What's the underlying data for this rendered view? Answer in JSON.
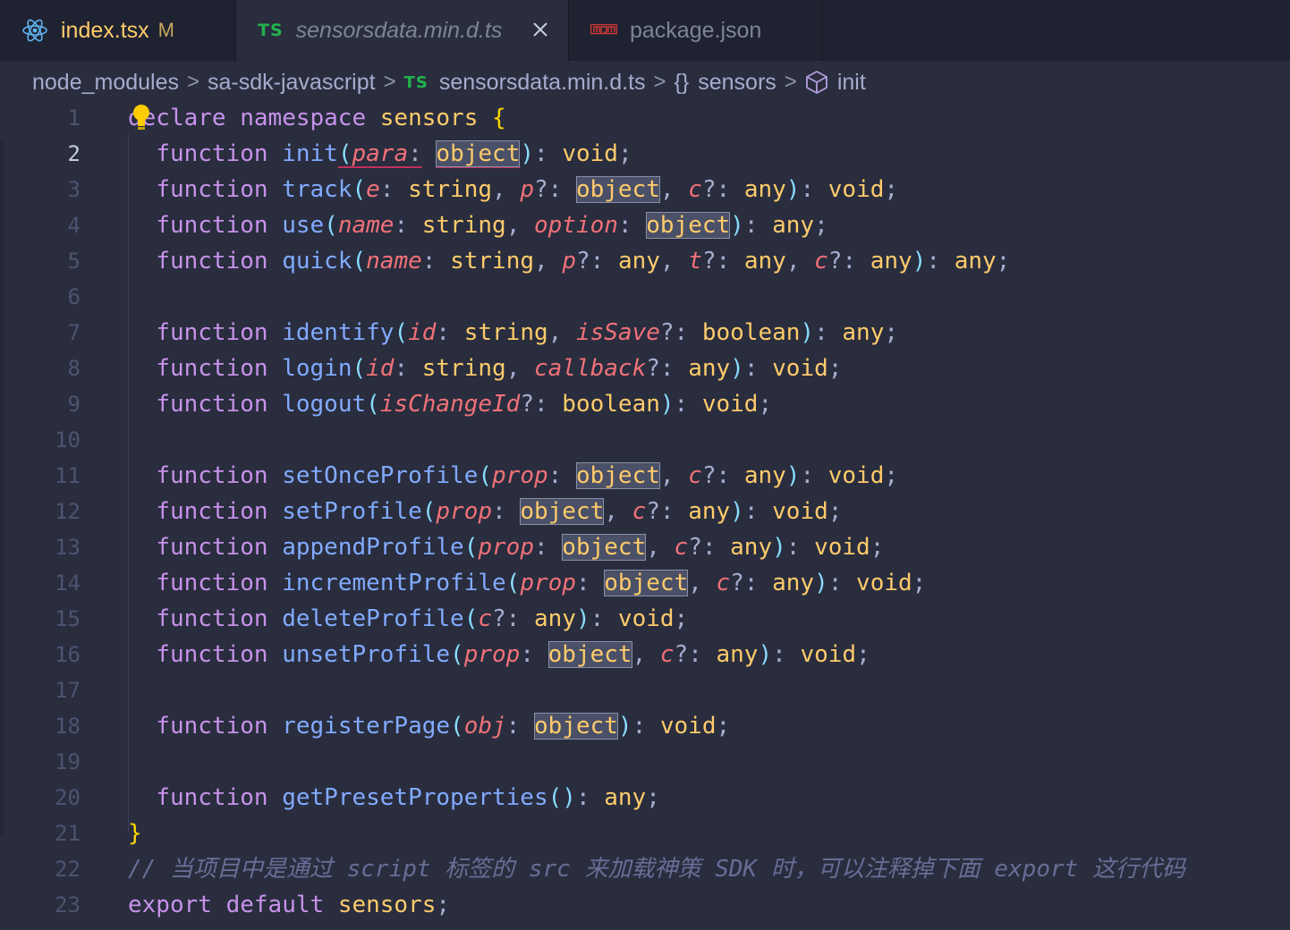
{
  "tabs": [
    {
      "icon": "react-icon",
      "label": "index.tsx",
      "status": "M"
    },
    {
      "icon": "ts-icon",
      "badge": "TS",
      "label": "sensorsdata.min.d.ts",
      "active": true
    },
    {
      "icon": "npm-icon",
      "label": "package.json"
    }
  ],
  "breadcrumb": {
    "items": [
      "node_modules",
      "sa-sdk-javascript",
      "sensorsdata.min.d.ts",
      "sensors",
      "init"
    ],
    "ts_badge": "TS",
    "braces": "{}",
    "separator": ">"
  },
  "editor": {
    "active_line": 2,
    "line_numbers": [
      "1",
      "2",
      "3",
      "4",
      "5",
      "6",
      "7",
      "8",
      "9",
      "10",
      "11",
      "12",
      "13",
      "14",
      "15",
      "16",
      "17",
      "18",
      "19",
      "20",
      "21",
      "22",
      "23"
    ],
    "lines": [
      "declare namespace sensors {",
      "  function init(para: object): void;",
      "  function track(e: string, p?: object, c?: any): void;",
      "  function use(name: string, option: object): any;",
      "  function quick(name: string, p?: any, t?: any, c?: any): any;",
      "",
      "  function identify(id: string, isSave?: boolean): any;",
      "  function login(id: string, callback?: any): void;",
      "  function logout(isChangeId?: boolean): void;",
      "",
      "  function setOnceProfile(prop: object, c?: any): void;",
      "  function setProfile(prop: object, c?: any): void;",
      "  function appendProfile(prop: object, c?: any): void;",
      "  function incrementProfile(prop: object, c?: any): void;",
      "  function deleteProfile(c?: any): void;",
      "  function unsetProfile(prop: object, c?: any): void;",
      "",
      "  function registerPage(obj: object): void;",
      "",
      "  function getPresetProperties(): any;",
      "}",
      "// 当项目中是通过 script 标签的 src 来加载神策 SDK 时，可以注释掉下面 export 这行代码",
      "export default sensors;"
    ]
  },
  "colors": {
    "keyword": "#c792ea",
    "function": "#82aaff",
    "param": "#f07178",
    "type": "#ffcb6b",
    "punct": "#89ddff",
    "comment": "#676e95",
    "background": "#292d3e",
    "tabbar": "#1f2230"
  }
}
